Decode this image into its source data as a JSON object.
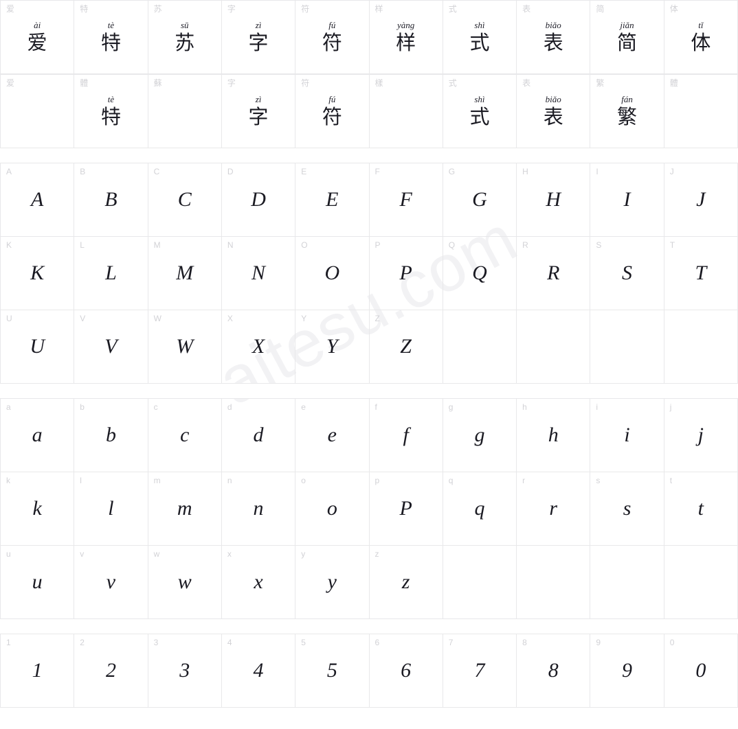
{
  "watermark": "aitesu.com",
  "blocks": [
    {
      "id": "cjk-simplified",
      "name": "cjk-simplified-row",
      "cells": [
        {
          "tag": "爱",
          "pinyin": "ài",
          "glyph": "爱",
          "type": "han"
        },
        {
          "tag": "特",
          "pinyin": "tè",
          "glyph": "特",
          "type": "han"
        },
        {
          "tag": "苏",
          "pinyin": "sū",
          "glyph": "苏",
          "type": "han"
        },
        {
          "tag": "字",
          "pinyin": "zì",
          "glyph": "字",
          "type": "han"
        },
        {
          "tag": "符",
          "pinyin": "fú",
          "glyph": "符",
          "type": "han"
        },
        {
          "tag": "样",
          "pinyin": "yàng",
          "glyph": "样",
          "type": "han"
        },
        {
          "tag": "式",
          "pinyin": "shì",
          "glyph": "式",
          "type": "han"
        },
        {
          "tag": "表",
          "pinyin": "biǎo",
          "glyph": "表",
          "type": "han"
        },
        {
          "tag": "简",
          "pinyin": "jiǎn",
          "glyph": "简",
          "type": "han"
        },
        {
          "tag": "体",
          "pinyin": "tǐ",
          "glyph": "体",
          "type": "han"
        }
      ]
    },
    {
      "id": "cjk-traditional",
      "name": "cjk-traditional-row",
      "cells": [
        {
          "tag": "爱",
          "pinyin": "",
          "glyph": "",
          "type": "han"
        },
        {
          "tag": "體",
          "pinyin": "tè",
          "glyph": "特",
          "type": "han"
        },
        {
          "tag": "蘇",
          "pinyin": "",
          "glyph": "",
          "type": "han"
        },
        {
          "tag": "字",
          "pinyin": "zì",
          "glyph": "字",
          "type": "han"
        },
        {
          "tag": "符",
          "pinyin": "fú",
          "glyph": "符",
          "type": "han"
        },
        {
          "tag": "樣",
          "pinyin": "",
          "glyph": "",
          "type": "han"
        },
        {
          "tag": "式",
          "pinyin": "shì",
          "glyph": "式",
          "type": "han"
        },
        {
          "tag": "表",
          "pinyin": "biǎo",
          "glyph": "表",
          "type": "han"
        },
        {
          "tag": "繁",
          "pinyin": "fán",
          "glyph": "繁",
          "type": "han"
        },
        {
          "tag": "體",
          "pinyin": "",
          "glyph": "",
          "type": "han"
        }
      ]
    },
    {
      "id": "uppercase",
      "name": "uppercase-latin-block",
      "cells": [
        {
          "tag": "A",
          "pinyin": "",
          "glyph": "A",
          "type": "lat"
        },
        {
          "tag": "B",
          "pinyin": "",
          "glyph": "B",
          "type": "lat"
        },
        {
          "tag": "C",
          "pinyin": "",
          "glyph": "C",
          "type": "lat"
        },
        {
          "tag": "D",
          "pinyin": "",
          "glyph": "D",
          "type": "lat"
        },
        {
          "tag": "E",
          "pinyin": "",
          "glyph": "E",
          "type": "lat"
        },
        {
          "tag": "F",
          "pinyin": "",
          "glyph": "F",
          "type": "lat"
        },
        {
          "tag": "G",
          "pinyin": "",
          "glyph": "G",
          "type": "lat"
        },
        {
          "tag": "H",
          "pinyin": "",
          "glyph": "H",
          "type": "lat"
        },
        {
          "tag": "I",
          "pinyin": "",
          "glyph": "I",
          "type": "lat"
        },
        {
          "tag": "J",
          "pinyin": "",
          "glyph": "J",
          "type": "lat"
        },
        {
          "tag": "K",
          "pinyin": "",
          "glyph": "K",
          "type": "lat"
        },
        {
          "tag": "L",
          "pinyin": "",
          "glyph": "L",
          "type": "lat"
        },
        {
          "tag": "M",
          "pinyin": "",
          "glyph": "M",
          "type": "lat"
        },
        {
          "tag": "N",
          "pinyin": "",
          "glyph": "N",
          "type": "lat"
        },
        {
          "tag": "O",
          "pinyin": "",
          "glyph": "O",
          "type": "lat"
        },
        {
          "tag": "P",
          "pinyin": "",
          "glyph": "P",
          "type": "lat"
        },
        {
          "tag": "Q",
          "pinyin": "",
          "glyph": "Q",
          "type": "lat"
        },
        {
          "tag": "R",
          "pinyin": "",
          "glyph": "R",
          "type": "lat"
        },
        {
          "tag": "S",
          "pinyin": "",
          "glyph": "S",
          "type": "lat"
        },
        {
          "tag": "T",
          "pinyin": "",
          "glyph": "T",
          "type": "lat"
        },
        {
          "tag": "U",
          "pinyin": "",
          "glyph": "U",
          "type": "lat"
        },
        {
          "tag": "V",
          "pinyin": "",
          "glyph": "V",
          "type": "lat"
        },
        {
          "tag": "W",
          "pinyin": "",
          "glyph": "W",
          "type": "lat"
        },
        {
          "tag": "X",
          "pinyin": "",
          "glyph": "X",
          "type": "lat"
        },
        {
          "tag": "Y",
          "pinyin": "",
          "glyph": "Y",
          "type": "lat"
        },
        {
          "tag": "Z",
          "pinyin": "",
          "glyph": "Z",
          "type": "lat"
        },
        {
          "tag": "",
          "pinyin": "",
          "glyph": "",
          "type": "lat"
        },
        {
          "tag": "",
          "pinyin": "",
          "glyph": "",
          "type": "lat"
        },
        {
          "tag": "",
          "pinyin": "",
          "glyph": "",
          "type": "lat"
        },
        {
          "tag": "",
          "pinyin": "",
          "glyph": "",
          "type": "lat"
        }
      ]
    },
    {
      "id": "lowercase",
      "name": "lowercase-latin-block",
      "cells": [
        {
          "tag": "a",
          "pinyin": "",
          "glyph": "a",
          "type": "lat"
        },
        {
          "tag": "b",
          "pinyin": "",
          "glyph": "b",
          "type": "lat"
        },
        {
          "tag": "c",
          "pinyin": "",
          "glyph": "c",
          "type": "lat"
        },
        {
          "tag": "d",
          "pinyin": "",
          "glyph": "d",
          "type": "lat"
        },
        {
          "tag": "e",
          "pinyin": "",
          "glyph": "e",
          "type": "lat"
        },
        {
          "tag": "f",
          "pinyin": "",
          "glyph": "f",
          "type": "lat"
        },
        {
          "tag": "g",
          "pinyin": "",
          "glyph": "g",
          "type": "lat"
        },
        {
          "tag": "h",
          "pinyin": "",
          "glyph": "h",
          "type": "lat"
        },
        {
          "tag": "i",
          "pinyin": "",
          "glyph": "i",
          "type": "lat"
        },
        {
          "tag": "j",
          "pinyin": "",
          "glyph": "j",
          "type": "lat"
        },
        {
          "tag": "k",
          "pinyin": "",
          "glyph": "k",
          "type": "lat"
        },
        {
          "tag": "l",
          "pinyin": "",
          "glyph": "l",
          "type": "lat"
        },
        {
          "tag": "m",
          "pinyin": "",
          "glyph": "m",
          "type": "lat"
        },
        {
          "tag": "n",
          "pinyin": "",
          "glyph": "n",
          "type": "lat"
        },
        {
          "tag": "o",
          "pinyin": "",
          "glyph": "o",
          "type": "lat"
        },
        {
          "tag": "p",
          "pinyin": "",
          "glyph": "P",
          "type": "lat"
        },
        {
          "tag": "q",
          "pinyin": "",
          "glyph": "q",
          "type": "lat"
        },
        {
          "tag": "r",
          "pinyin": "",
          "glyph": "r",
          "type": "lat"
        },
        {
          "tag": "s",
          "pinyin": "",
          "glyph": "s",
          "type": "lat"
        },
        {
          "tag": "t",
          "pinyin": "",
          "glyph": "t",
          "type": "lat"
        },
        {
          "tag": "u",
          "pinyin": "",
          "glyph": "u",
          "type": "lat"
        },
        {
          "tag": "v",
          "pinyin": "",
          "glyph": "v",
          "type": "lat"
        },
        {
          "tag": "w",
          "pinyin": "",
          "glyph": "w",
          "type": "lat"
        },
        {
          "tag": "x",
          "pinyin": "",
          "glyph": "x",
          "type": "lat"
        },
        {
          "tag": "y",
          "pinyin": "",
          "glyph": "y",
          "type": "lat"
        },
        {
          "tag": "z",
          "pinyin": "",
          "glyph": "z",
          "type": "lat"
        },
        {
          "tag": "",
          "pinyin": "",
          "glyph": "",
          "type": "lat"
        },
        {
          "tag": "",
          "pinyin": "",
          "glyph": "",
          "type": "lat"
        },
        {
          "tag": "",
          "pinyin": "",
          "glyph": "",
          "type": "lat"
        },
        {
          "tag": "",
          "pinyin": "",
          "glyph": "",
          "type": "lat"
        }
      ]
    },
    {
      "id": "digits",
      "name": "digits-block",
      "cells": [
        {
          "tag": "1",
          "pinyin": "",
          "glyph": "1",
          "type": "lat"
        },
        {
          "tag": "2",
          "pinyin": "",
          "glyph": "2",
          "type": "lat"
        },
        {
          "tag": "3",
          "pinyin": "",
          "glyph": "3",
          "type": "lat"
        },
        {
          "tag": "4",
          "pinyin": "",
          "glyph": "4",
          "type": "lat"
        },
        {
          "tag": "5",
          "pinyin": "",
          "glyph": "5",
          "type": "lat"
        },
        {
          "tag": "6",
          "pinyin": "",
          "glyph": "6",
          "type": "lat"
        },
        {
          "tag": "7",
          "pinyin": "",
          "glyph": "7",
          "type": "lat"
        },
        {
          "tag": "8",
          "pinyin": "",
          "glyph": "8",
          "type": "lat"
        },
        {
          "tag": "9",
          "pinyin": "",
          "glyph": "9",
          "type": "lat"
        },
        {
          "tag": "0",
          "pinyin": "",
          "glyph": "0",
          "type": "lat"
        }
      ]
    }
  ]
}
